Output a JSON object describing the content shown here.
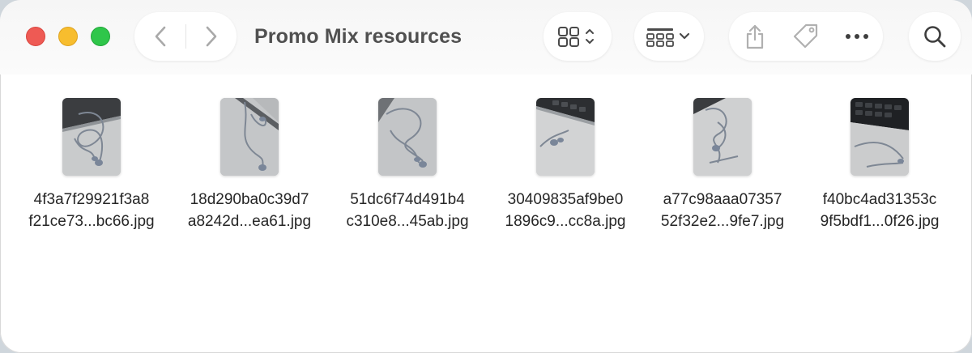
{
  "window": {
    "title": "Promo Mix resources"
  },
  "toolbar": {
    "traffic_lights": [
      {
        "name": "close",
        "color": "#ee5a54"
      },
      {
        "name": "minimize",
        "color": "#f7bd2e"
      },
      {
        "name": "zoom",
        "color": "#2fc64a"
      }
    ],
    "icons": {
      "back": "chevron-left-icon",
      "forward": "chevron-right-icon",
      "view_mode": "icon-grid-view-icon",
      "group": "group-by-icon",
      "share": "share-icon",
      "tag": "tag-icon",
      "more": "more-icon",
      "search": "search-icon"
    }
  },
  "files": [
    {
      "line1": "4f3a7f29921f3a8",
      "line2": "f21ce73...bc66.jpg",
      "thumb": "earphones-on-laptop"
    },
    {
      "line1": "18d290ba0c39d7",
      "line2": "a8242d...ea61.jpg",
      "thumb": "earphones-on-laptop"
    },
    {
      "line1": "51dc6f74d491b4",
      "line2": "c310e8...45ab.jpg",
      "thumb": "earphones-on-laptop"
    },
    {
      "line1": "30409835af9be0",
      "line2": "1896c9...cc8a.jpg",
      "thumb": "earphones-on-laptop"
    },
    {
      "line1": "a77c98aaa07357",
      "line2": "52f32e2...9fe7.jpg",
      "thumb": "earphones-on-laptop"
    },
    {
      "line1": "f40bc4ad31353c",
      "line2": "9f5bdf1...0f26.jpg",
      "thumb": "earphones-on-laptop"
    }
  ]
}
